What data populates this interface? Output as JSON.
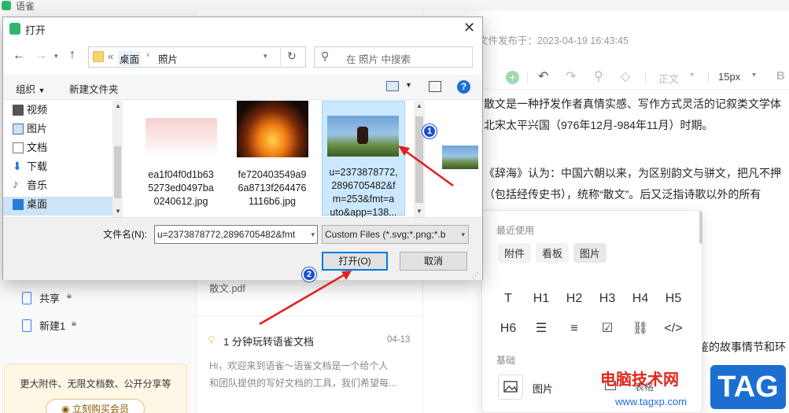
{
  "app": {
    "title": "语雀"
  },
  "background": {
    "publish_time": "文件发布于：2023-04-19 16:43:45",
    "toolbar": {
      "style_label": "正文",
      "font_size": "15px"
    },
    "doc_lines": [
      "散文是一种抒发作者真情实感、写作方式灵活的记叙类文学体",
      "北宋太平兴国（976年12月-984年11月）时期。",
      "《辞海》认为：中国六朝以来，为区别韵文与骈文，把凡不押",
      "（包括经传史书），统称“散文”。后又泛指诗歌以外的所有",
      "鉴的故事情节和环"
    ],
    "sidebar": {
      "items": [
        {
          "label": "共享",
          "icon": "book-icon"
        },
        {
          "label": "新建1",
          "icon": "book-icon"
        }
      ],
      "promo_text": "更大附件、无限文档数、公开分享等",
      "promo_button": "立刻购买会员"
    },
    "middle": {
      "pdf_name": "散文.pdf",
      "article": {
        "title": "1 分钟玩转语雀文档",
        "date": "04-13",
        "excerpt_1": "Hi，欢迎来到语雀～语雀文档是一个给个人",
        "excerpt_2": "和团队提供的写好文档的工具，我们希望每..."
      }
    },
    "insert_popup": {
      "recent_label": "最近使用",
      "recent_tags": [
        "附件",
        "看板",
        "图片"
      ],
      "heading_row1": [
        "T",
        "H1",
        "H2",
        "H3",
        "H4",
        "H5"
      ],
      "heading_row2": [
        "H6",
        "bullet-list-icon",
        "ordered-list-icon",
        "task-list-icon",
        "link-icon",
        "code-icon"
      ],
      "basic_label": "基础",
      "basic_item": "图片",
      "table_item": "表格"
    }
  },
  "dialog": {
    "title": "打开",
    "address": {
      "prefix": "«",
      "segments": [
        "桌面",
        "照片"
      ]
    },
    "search_placeholder": "在 照片 中搜索",
    "commands": {
      "organize": "组织",
      "new_folder": "新建文件夹"
    },
    "tree": [
      {
        "label": "视频",
        "icon": "video-folder-icon"
      },
      {
        "label": "图片",
        "icon": "pictures-folder-icon"
      },
      {
        "label": "文档",
        "icon": "documents-folder-icon"
      },
      {
        "label": "下载",
        "icon": "download-folder-icon"
      },
      {
        "label": "音乐",
        "icon": "music-folder-icon"
      },
      {
        "label": "桌面",
        "icon": "desktop-folder-icon",
        "selected": true
      }
    ],
    "files": [
      {
        "name_lines": [
          "ea1f04f0d1b63",
          "5273ed0497ba",
          "0240612.jpg"
        ],
        "thumb": "pink-gradient"
      },
      {
        "name_lines": [
          "fe720403549a9",
          "6a8713f264476",
          "1116b6.jpg"
        ],
        "thumb": "fire"
      },
      {
        "name_lines": [
          "u=2373878772,",
          "2896705482&f",
          "m=253&fmt=a",
          "uto&app=138..."
        ],
        "thumb": "anime",
        "selected": true
      }
    ],
    "filename_label": "文件名(N):",
    "filename_value": "u=2373878772,2896705482&fmt",
    "filetype_value": "Custom Files (*.svg;*.png;*.b",
    "open_button": "打开(O)",
    "cancel_button": "取消"
  },
  "annotations": {
    "badge1": "1",
    "badge2": "2"
  },
  "watermark": {
    "site_name": "电脑技术网",
    "url": "www.tagxp.com",
    "tag": "TAG"
  },
  "colors": {
    "accent": "#0078d7",
    "selection": "#cce4f7",
    "badge": "#1b4fd1",
    "arrow": "#e02020",
    "watermark_red": "#e1261c",
    "watermark_blue": "#1b6fd1"
  }
}
